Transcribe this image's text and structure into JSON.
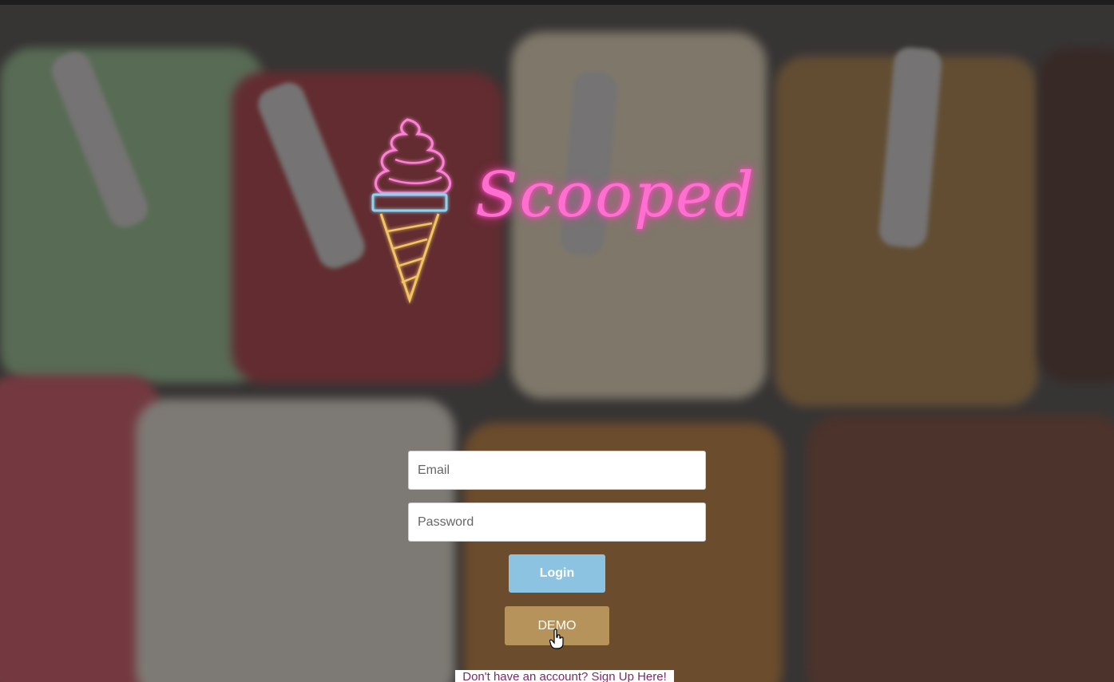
{
  "brand": {
    "name": "Scooped",
    "logo_icon": "ice-cream-cone-icon",
    "neon_pink": "#ff6fd0",
    "neon_blue": "#8ed4f0",
    "neon_yellow": "#f2c463"
  },
  "login_form": {
    "email_placeholder": "Email",
    "password_placeholder": "Password",
    "login_label": "Login",
    "demo_label": "DEMO",
    "signup_text": "Don't have an account? Sign Up Here!"
  },
  "colors": {
    "login_button": "#8cc3e1",
    "demo_button": "#b6935a"
  }
}
